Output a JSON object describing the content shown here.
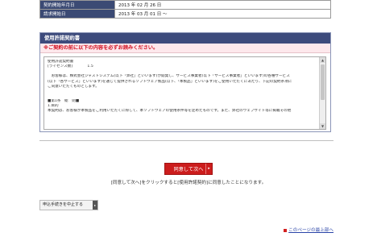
{
  "info": {
    "rows": [
      {
        "label": "契約開始年月日",
        "value": "2013 年 02 月 26 日"
      },
      {
        "label": "請求開始日",
        "value": "2013 年 03 月 01 日 ～"
      }
    ]
  },
  "license": {
    "header": "使用許諾契約書",
    "notice": "※ご契約の前に以下の内容を必ずお読みください。",
    "terms_lines": [
      "使用許諾契約書",
      "[ライセンス数]　　　　1.5",
      "",
      "　お客様は、株式会社ジャストシステム(以下「弊社」といいます)が開発し、サービス事業者(以下「サービス事業者」といいます)の各種サービス",
      "(以下「各サービス」といいます)を通じて提供されるソフトウェア製品(以下、「本製品」といいます)をご使用いただくにあたり、下記の契約条項に",
      "ご同意いただくものとします。",
      "",
      "",
      "■第1条　総　則■",
      "1.目的",
      "本契約は、お客様が本製品をご利用いただくに際して、本ソフトウェアの使用条件等を定めたものです。また、弊社のウェブサイト等に掲載その他"
    ]
  },
  "actions": {
    "agree_label": "同意して次へ",
    "agree_note": "[同意して次へ]をクリックすると[使用許諾契約]に同意したことになります。",
    "cancel_label": "申込手続きを中止する",
    "top_link": "このページの最上部へ"
  }
}
